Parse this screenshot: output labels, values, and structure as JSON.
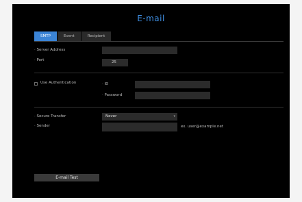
{
  "title": "E-mail",
  "tabs": [
    {
      "label": "SMTP",
      "active": true
    },
    {
      "label": "Event",
      "active": false
    },
    {
      "label": "Recipient",
      "active": false
    }
  ],
  "server": {
    "address_label": "Server Address",
    "address_value": "",
    "port_label": "Port",
    "port_value": "25"
  },
  "auth": {
    "label": "Use Authentication",
    "checked": false,
    "id_label": "ID",
    "id_value": "",
    "password_label": "Password",
    "password_value": ""
  },
  "secure": {
    "label": "Secure Transfer",
    "value": "Never"
  },
  "sender": {
    "label": "Sender",
    "value": "",
    "hint": "ex. user@example.net"
  },
  "test_button": "E-mail Test",
  "colors": {
    "accent": "#3b84d6",
    "title": "#3f8fe3",
    "background": "#000000"
  }
}
